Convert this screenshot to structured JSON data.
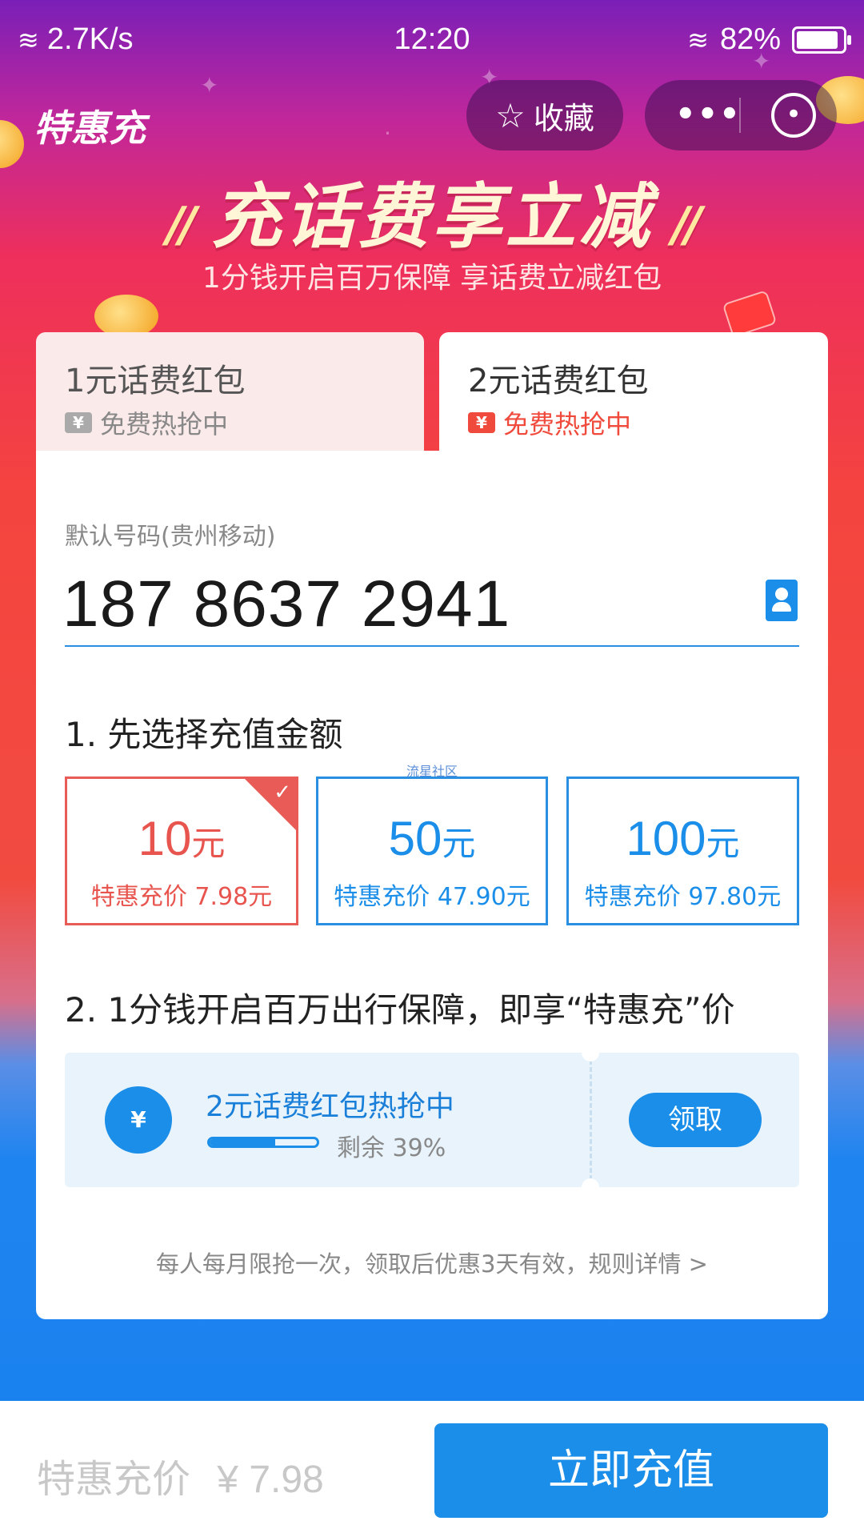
{
  "status_bar": {
    "net_speed": "2.7K/s",
    "time": "12:20",
    "battery": "82%",
    "battery_level": 0.82
  },
  "header": {
    "app_title": "特惠充",
    "favorite_label": "收藏",
    "more_label": "•••"
  },
  "hero": {
    "title": "充话费享立减",
    "slash_left": "//",
    "slash_right": "//",
    "subtitle": "1分钱开启百万保障 享话费立减红包"
  },
  "tabs": [
    {
      "title": "1元话费红包",
      "subtitle": "免费热抢中",
      "selected": false
    },
    {
      "title": "2元话费红包",
      "subtitle": "免费热抢中",
      "selected": true
    }
  ],
  "phone": {
    "label": "默认号码(贵州移动)",
    "number": "187 8637 2941"
  },
  "step1_title": "1. 先选择充值金额",
  "watermark": "流星社区",
  "amounts": [
    {
      "value": "10",
      "unit": "元",
      "price": "特惠充价 7.98元",
      "selected": true
    },
    {
      "value": "50",
      "unit": "元",
      "price": "特惠充价 47.90元",
      "selected": false
    },
    {
      "value": "100",
      "unit": "元",
      "price": "特惠充价 97.80元",
      "selected": false
    }
  ],
  "step2_title": "2. 1分钱开启百万出行保障，即享“特惠充”价",
  "promo": {
    "icon_text": "¥",
    "title": "2元话费红包热抢中",
    "remaining_label": "剩余 39%",
    "remaining_fraction": 0.39,
    "claim_label": "领取"
  },
  "rules_text": "每人每月限抢一次，领取后优惠3天有效，规则详情 >",
  "bottom": {
    "price_label": "特惠充价",
    "price_value": "¥ 7.98",
    "submit_label": "立即充值"
  },
  "colors": {
    "accent_blue": "#1a8ee8",
    "accent_red": "#e8554f"
  }
}
